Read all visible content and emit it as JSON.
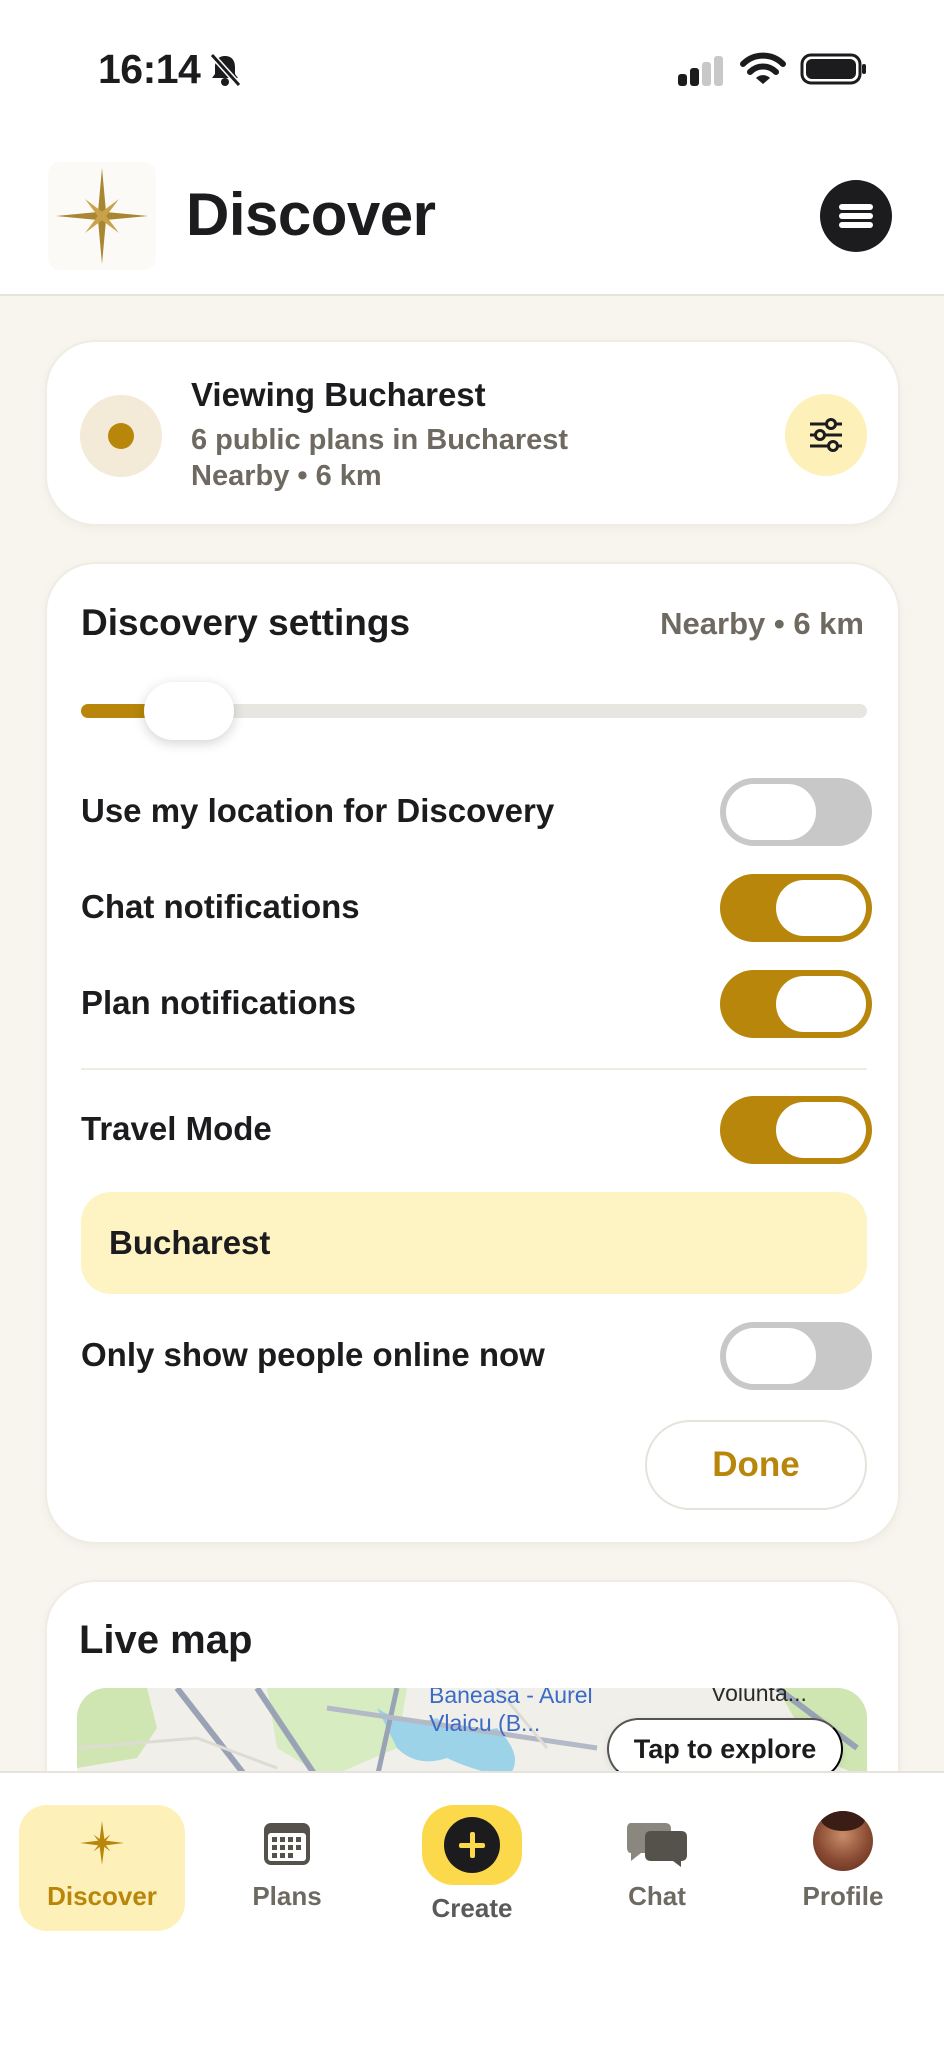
{
  "status_bar": {
    "time": "16:14"
  },
  "header": {
    "title": "Discover",
    "logo_icon": "compass-star-icon",
    "menu_icon": "menu-icon"
  },
  "viewing": {
    "title": "Viewing Bucharest",
    "subtitle": "6 public plans in Bucharest",
    "range": "Nearby • 6 km"
  },
  "settings": {
    "title": "Discovery settings",
    "range_label": "Nearby • 6 km",
    "slider_fraction": 0.11,
    "rows": {
      "use_location": {
        "label": "Use my location for Discovery",
        "on": false
      },
      "chat_notifications": {
        "label": "Chat notifications",
        "on": true
      },
      "plan_notifications": {
        "label": "Plan notifications",
        "on": true
      },
      "travel_mode": {
        "label": "Travel Mode",
        "on": true
      },
      "online_only": {
        "label": "Only show people online now",
        "on": false
      }
    },
    "travel_city": "Bucharest",
    "done_label": "Done"
  },
  "map": {
    "title": "Live map",
    "label_line1": "Baneasa - Aurel",
    "label_line2": "Vlaicu (B...",
    "label_right": "Volunta...",
    "explore_label": "Tap to explore"
  },
  "tabs": {
    "discover": "Discover",
    "plans": "Plans",
    "create": "Create",
    "chat": "Chat",
    "profile": "Profile"
  },
  "colors": {
    "accent": "#b8860b",
    "accent_light": "#fdf0b8",
    "create_yellow": "#fcd94a",
    "background": "#f8f5ee"
  }
}
